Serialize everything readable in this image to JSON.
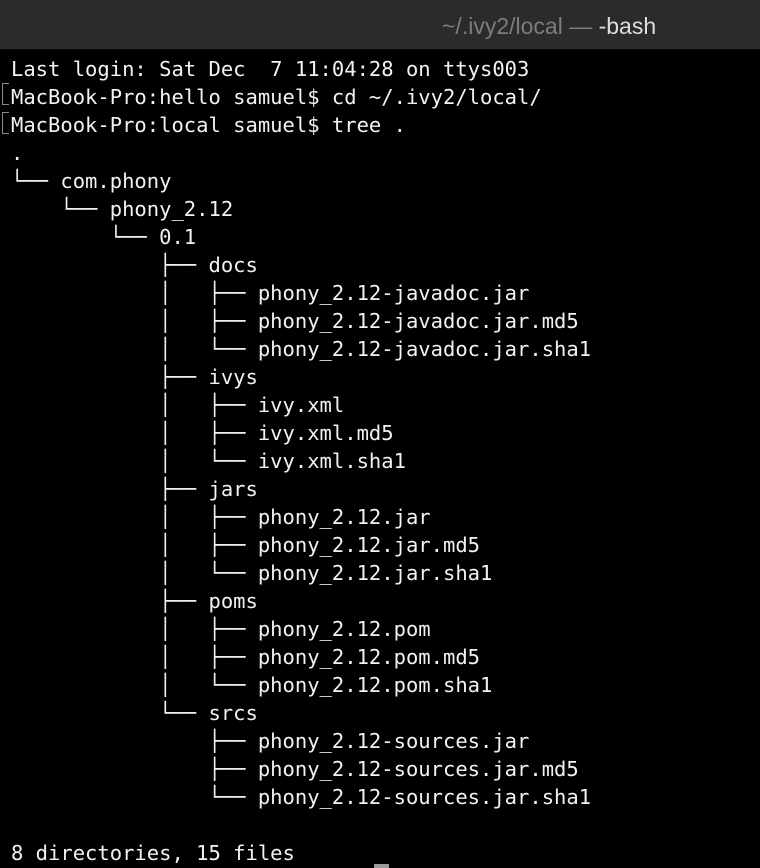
{
  "window": {
    "title_path": "~/.ivy2/local",
    "title_separator": " — ",
    "title_process": "-bash"
  },
  "terminal": {
    "lines": [
      "Last login: Sat Dec  7 11:04:28 on ttys003",
      "MacBook-Pro:hello samuel$ cd ~/.ivy2/local/",
      "MacBook-Pro:local samuel$ tree .",
      ".",
      "└── com.phony",
      "    └── phony_2.12",
      "        └── 0.1",
      "            ├── docs",
      "            │   ├── phony_2.12-javadoc.jar",
      "            │   ├── phony_2.12-javadoc.jar.md5",
      "            │   └── phony_2.12-javadoc.jar.sha1",
      "            ├── ivys",
      "            │   ├── ivy.xml",
      "            │   ├── ivy.xml.md5",
      "            │   └── ivy.xml.sha1",
      "            ├── jars",
      "            │   ├── phony_2.12.jar",
      "            │   ├── phony_2.12.jar.md5",
      "            │   └── phony_2.12.jar.sha1",
      "            ├── poms",
      "            │   ├── phony_2.12.pom",
      "            │   ├── phony_2.12.pom.md5",
      "            │   └── phony_2.12.pom.sha1",
      "            └── srcs",
      "                ├── phony_2.12-sources.jar",
      "                ├── phony_2.12-sources.jar.md5",
      "                └── phony_2.12-sources.jar.sha1",
      "",
      "8 directories, 15 files"
    ]
  }
}
